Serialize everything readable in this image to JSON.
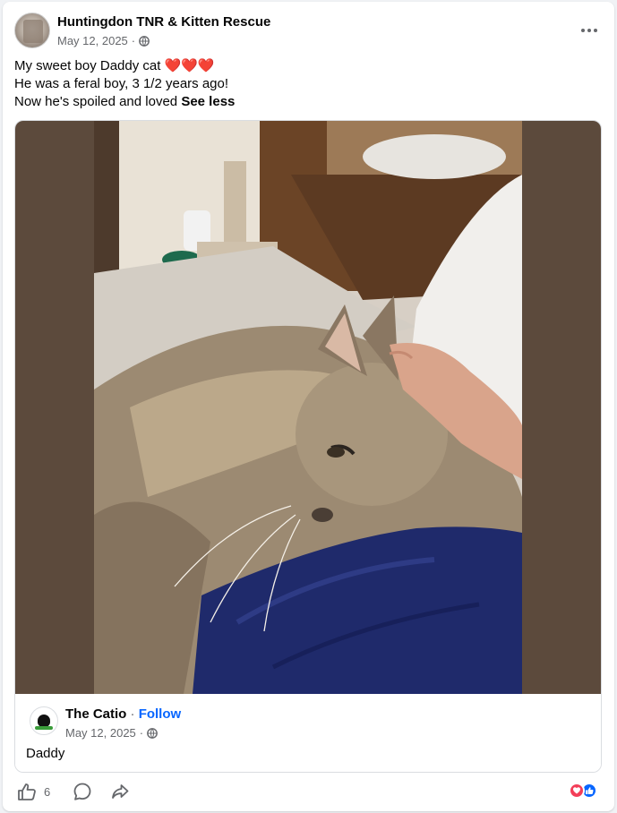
{
  "post": {
    "page_name": "Huntingdon TNR & Kitten Rescue",
    "date": "May 12, 2025",
    "separator": "·",
    "lines": [
      "My sweet boy Daddy cat ",
      "He was a feral boy, 3 1/2 years ago!",
      "Now he's spoiled and loved "
    ],
    "hearts": "❤️❤️❤️",
    "see_less": "See less"
  },
  "shared": {
    "name": "The Catio",
    "separator": "·",
    "follow": "Follow",
    "date": "May 12, 2025",
    "caption": "Daddy"
  },
  "actions": {
    "like_count": "6"
  },
  "icons": {
    "more": "more-options-icon",
    "globe": "globe-icon",
    "like": "like-icon",
    "comment": "comment-icon",
    "share": "share-icon",
    "love_reaction": "love-reaction-icon",
    "like_reaction": "like-reaction-icon"
  },
  "colors": {
    "link": "#0866ff",
    "secondary_text": "#65676b",
    "photo_frame": "#5c4a3c",
    "love": "#f33e58",
    "like": "#0866ff"
  }
}
